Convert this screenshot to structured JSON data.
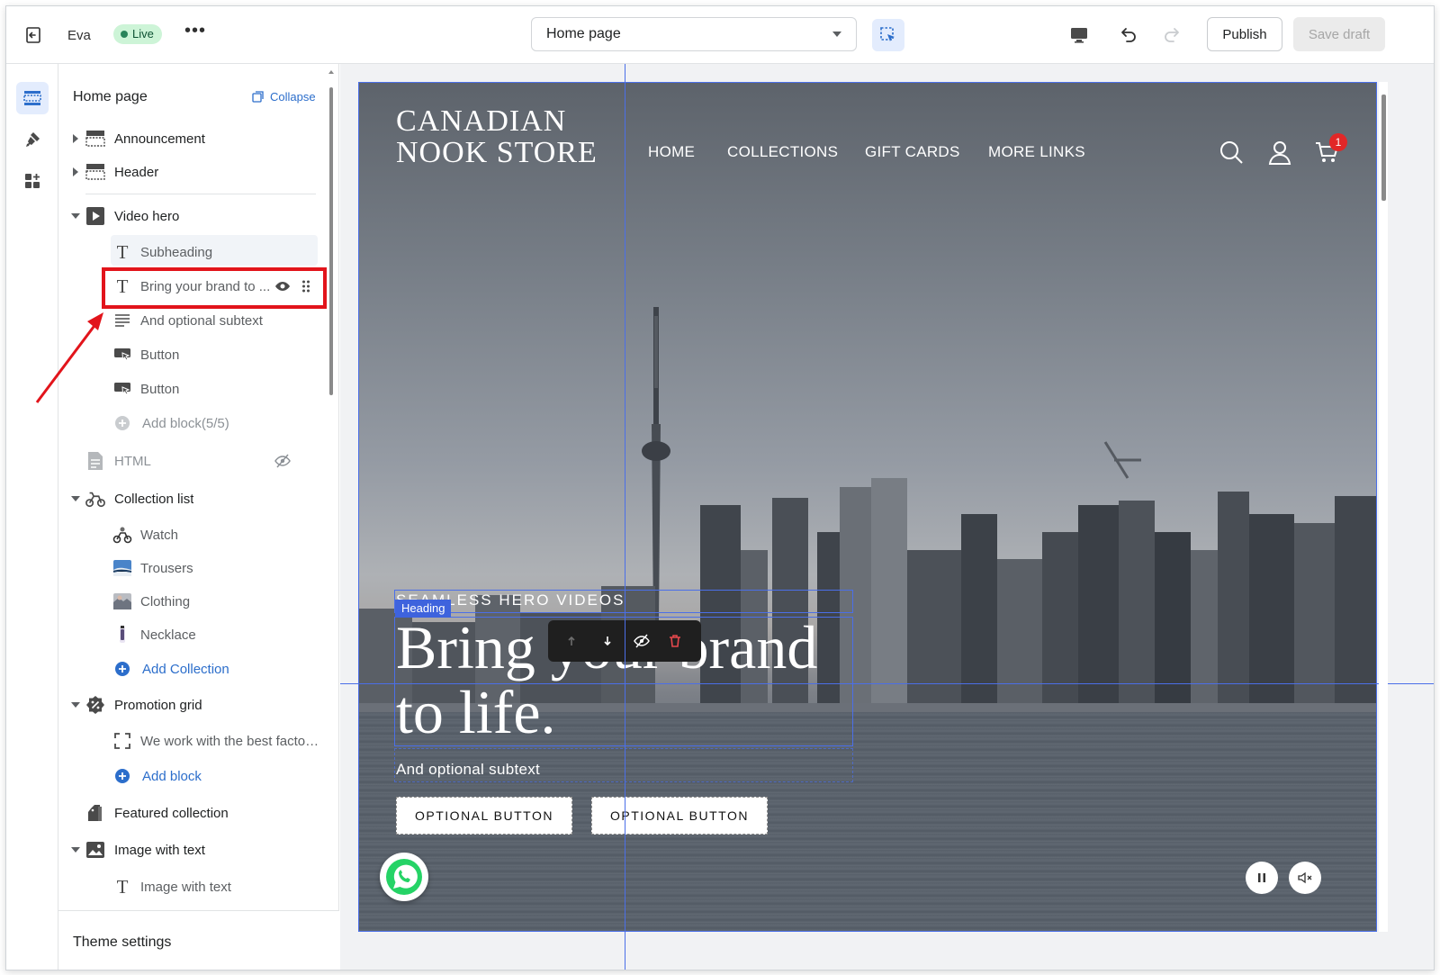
{
  "topbar": {
    "store_name": "Eva",
    "status_badge": "Live",
    "more_label": "•••",
    "page_select": "Home page",
    "publish_label": "Publish",
    "save_draft_label": "Save draft"
  },
  "sidebar": {
    "title": "Home page",
    "collapse_label": "Collapse",
    "items": [
      {
        "label": "Announcement",
        "icon": "section-icon"
      },
      {
        "label": "Header",
        "icon": "section-icon"
      },
      {
        "label": "Video hero",
        "icon": "play-icon"
      },
      {
        "label": "Subheading",
        "icon": "text-icon"
      },
      {
        "label": "Bring your brand to ...",
        "icon": "text-icon"
      },
      {
        "label": "And optional subtext",
        "icon": "paragraph-icon"
      },
      {
        "label": "Button",
        "icon": "button-icon"
      },
      {
        "label": "Button",
        "icon": "button-icon"
      },
      {
        "label": "Add block(5/5)",
        "icon": "plus-circle-icon"
      },
      {
        "label": "HTML",
        "icon": "file-icon"
      },
      {
        "label": "Collection list",
        "icon": "collection-icon"
      },
      {
        "label": "Watch",
        "icon": "thumbnail-icon"
      },
      {
        "label": "Trousers",
        "icon": "thumbnail-icon"
      },
      {
        "label": "Clothing",
        "icon": "thumbnail-icon"
      },
      {
        "label": "Necklace",
        "icon": "thumbnail-icon"
      },
      {
        "label": "Add Collection",
        "icon": "plus-circle-icon"
      },
      {
        "label": "Promotion grid",
        "icon": "discount-icon"
      },
      {
        "label": "We work with the best factori...",
        "icon": "frame-icon"
      },
      {
        "label": "Add block",
        "icon": "plus-circle-icon"
      },
      {
        "label": "Featured collection",
        "icon": "shopping-bag-icon"
      },
      {
        "label": "Image with text",
        "icon": "image-icon"
      },
      {
        "label": "Image with text",
        "icon": "text-icon"
      }
    ],
    "footer_label": "Theme settings"
  },
  "preview": {
    "store_logo": "CANADIAN NOOK STORE",
    "nav": [
      "HOME",
      "COLLECTIONS",
      "GIFT CARDS",
      "MORE LINKS"
    ],
    "cart_count": "1",
    "hero_subheading": "SEAMLESS HERO VIDEOS",
    "selected_tag": "Heading",
    "hero_heading": "Bring your brand to life.",
    "hero_subtext": "And optional subtext",
    "button_1": "OPTIONAL BUTTON",
    "button_2": "OPTIONAL BUTTON"
  },
  "colors": {
    "accent": "#2c6ecb",
    "highlight": "#e2141b",
    "live": "#29845a",
    "selection_outline": "#4b6fe8"
  }
}
